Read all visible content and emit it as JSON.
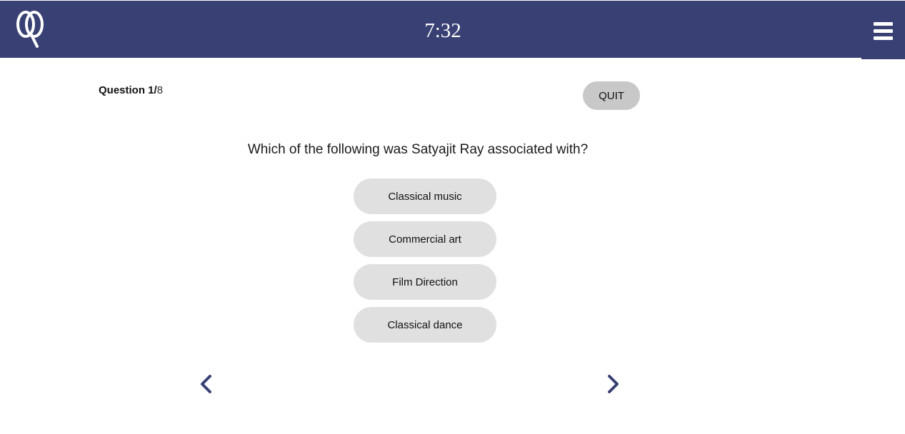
{
  "header": {
    "timer": "7:32",
    "logo_icon": "quiz-logo-icon",
    "menu_icon": "hamburger-menu-icon",
    "background_color": "#394174"
  },
  "quiz": {
    "question_label": "Question 1/",
    "total_questions": "8",
    "current_question": 1,
    "quit_label": "QUIT",
    "question_text": "Which of the following was Satyajit Ray associated with?",
    "options": [
      "Classical music",
      "Commercial art",
      "Film Direction",
      "Classical dance"
    ]
  },
  "navigation": {
    "prev_icon": "chevron-left-icon",
    "next_icon": "chevron-right-icon",
    "accent_color": "#394174"
  }
}
